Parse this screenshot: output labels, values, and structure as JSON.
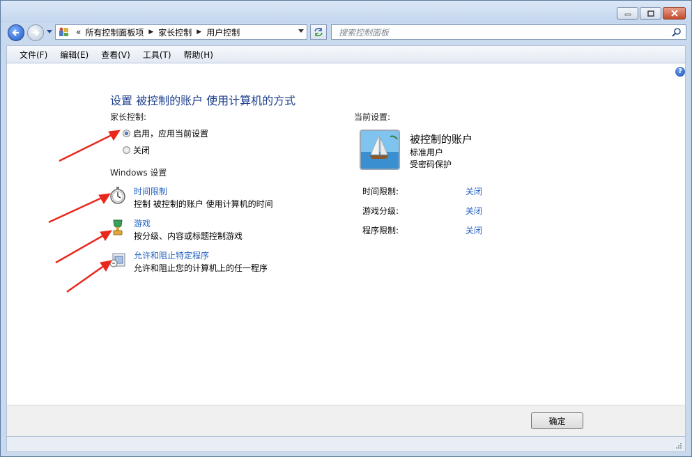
{
  "address": {
    "overflow": "«",
    "crumbs": [
      "所有控制面板项",
      "家长控制",
      "用户控制"
    ],
    "separator": "▶"
  },
  "search": {
    "placeholder": "搜索控制面板"
  },
  "menu": [
    "文件(F)",
    "编辑(E)",
    "查看(V)",
    "工具(T)",
    "帮助(H)"
  ],
  "help_label": "?",
  "main": {
    "title": "设置 被控制的账户 使用计算机的方式",
    "parental_label": "家长控制:",
    "options": [
      {
        "label": "启用，应用当前设置",
        "selected": true
      },
      {
        "label": "关闭",
        "selected": false
      }
    ],
    "windows_settings_label": "Windows 设置",
    "settings": [
      {
        "icon": "stopwatch-icon",
        "title": "时间限制",
        "desc": "控制 被控制的账户 使用计算机的时间"
      },
      {
        "icon": "games-trophy-icon",
        "title": "游戏",
        "desc": "按分级、内容或标题控制游戏"
      },
      {
        "icon": "program-blocker-icon",
        "title": "允许和阻止特定程序",
        "desc": "允许和阻止您的计算机上的任一程序"
      }
    ]
  },
  "current": {
    "label": "当前设置:",
    "account_name": "被控制的账户",
    "account_type": "标准用户",
    "account_protection": "受密码保护",
    "rows": [
      {
        "label": "时间限制:",
        "value": "关闭"
      },
      {
        "label": "游戏分级:",
        "value": "关闭"
      },
      {
        "label": "程序限制:",
        "value": "关闭"
      }
    ]
  },
  "footer": {
    "ok_label": "确定"
  },
  "colors": {
    "title": "#1b3e8b",
    "link": "#1f5fbf",
    "arrow": "#e8281c"
  }
}
